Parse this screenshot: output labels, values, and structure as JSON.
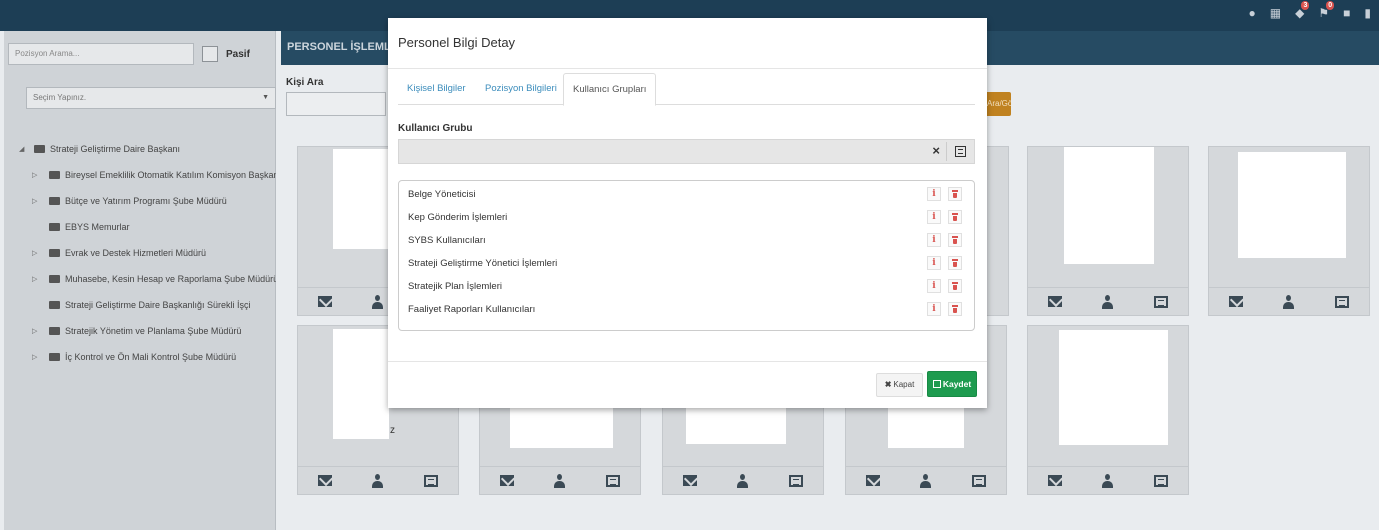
{
  "sidebar": {
    "search_placeholder": "Pozisyon Arama...",
    "pasif_label": "Pasif",
    "structure_select": "Seçim Yapınız.",
    "tree": [
      "Strateji Geliştirme Daire Başkanı",
      "Bireysel Emeklilik Otomatik Katılım Komisyon Başkanı",
      "Bütçe ve Yatırım Programı Şube Müdürü",
      "EBYS Memurlar",
      "Evrak ve Destek Hizmetleri Müdürü",
      "Muhasebe, Kesin Hesap ve Raporlama Şube Müdürü",
      "Strateji Geliştirme Daire Başkanlığı Sürekli İşçi",
      "Stratejik Yönetim ve Planlama Şube Müdürü",
      "İç Kontrol ve Ön Mali Kontrol Şube Müdürü"
    ]
  },
  "main": {
    "header_title": "PERSONEL İŞLEMLERİ",
    "search_label": "Kişi Ara",
    "search_button": "Ara/Gönder",
    "stray_text": "z"
  },
  "modal": {
    "title": "Personel Bilgi Detay",
    "tabs": [
      "Kişisel Bilgiler",
      "Pozisyon Bilgileri",
      "Kullanıcı Grupları"
    ],
    "active_tab": "Kullanıcı Grupları",
    "group_label": "Kullanıcı Grubu",
    "clear_symbol": "×",
    "groups": [
      "Belge Yöneticisi",
      "Kep Gönderim İşlemleri",
      "SYBS Kullanıcıları",
      "Strateji Geliştirme Yönetici İşlemleri",
      "Stratejik Plan İşlemleri",
      "Faaliyet Raporları Kullanıcıları"
    ],
    "info_symbol": "i",
    "close_button": "Kapat",
    "save_button": "Kaydet"
  },
  "topbar": {
    "badges": [
      "3",
      "0"
    ]
  },
  "colors": {
    "topbar": "#1d3e55",
    "header": "#264b63",
    "primary_link": "#3c8dbc",
    "save_green": "#1e9b4f",
    "danger": "#d9534f",
    "warning": "#c08220"
  }
}
